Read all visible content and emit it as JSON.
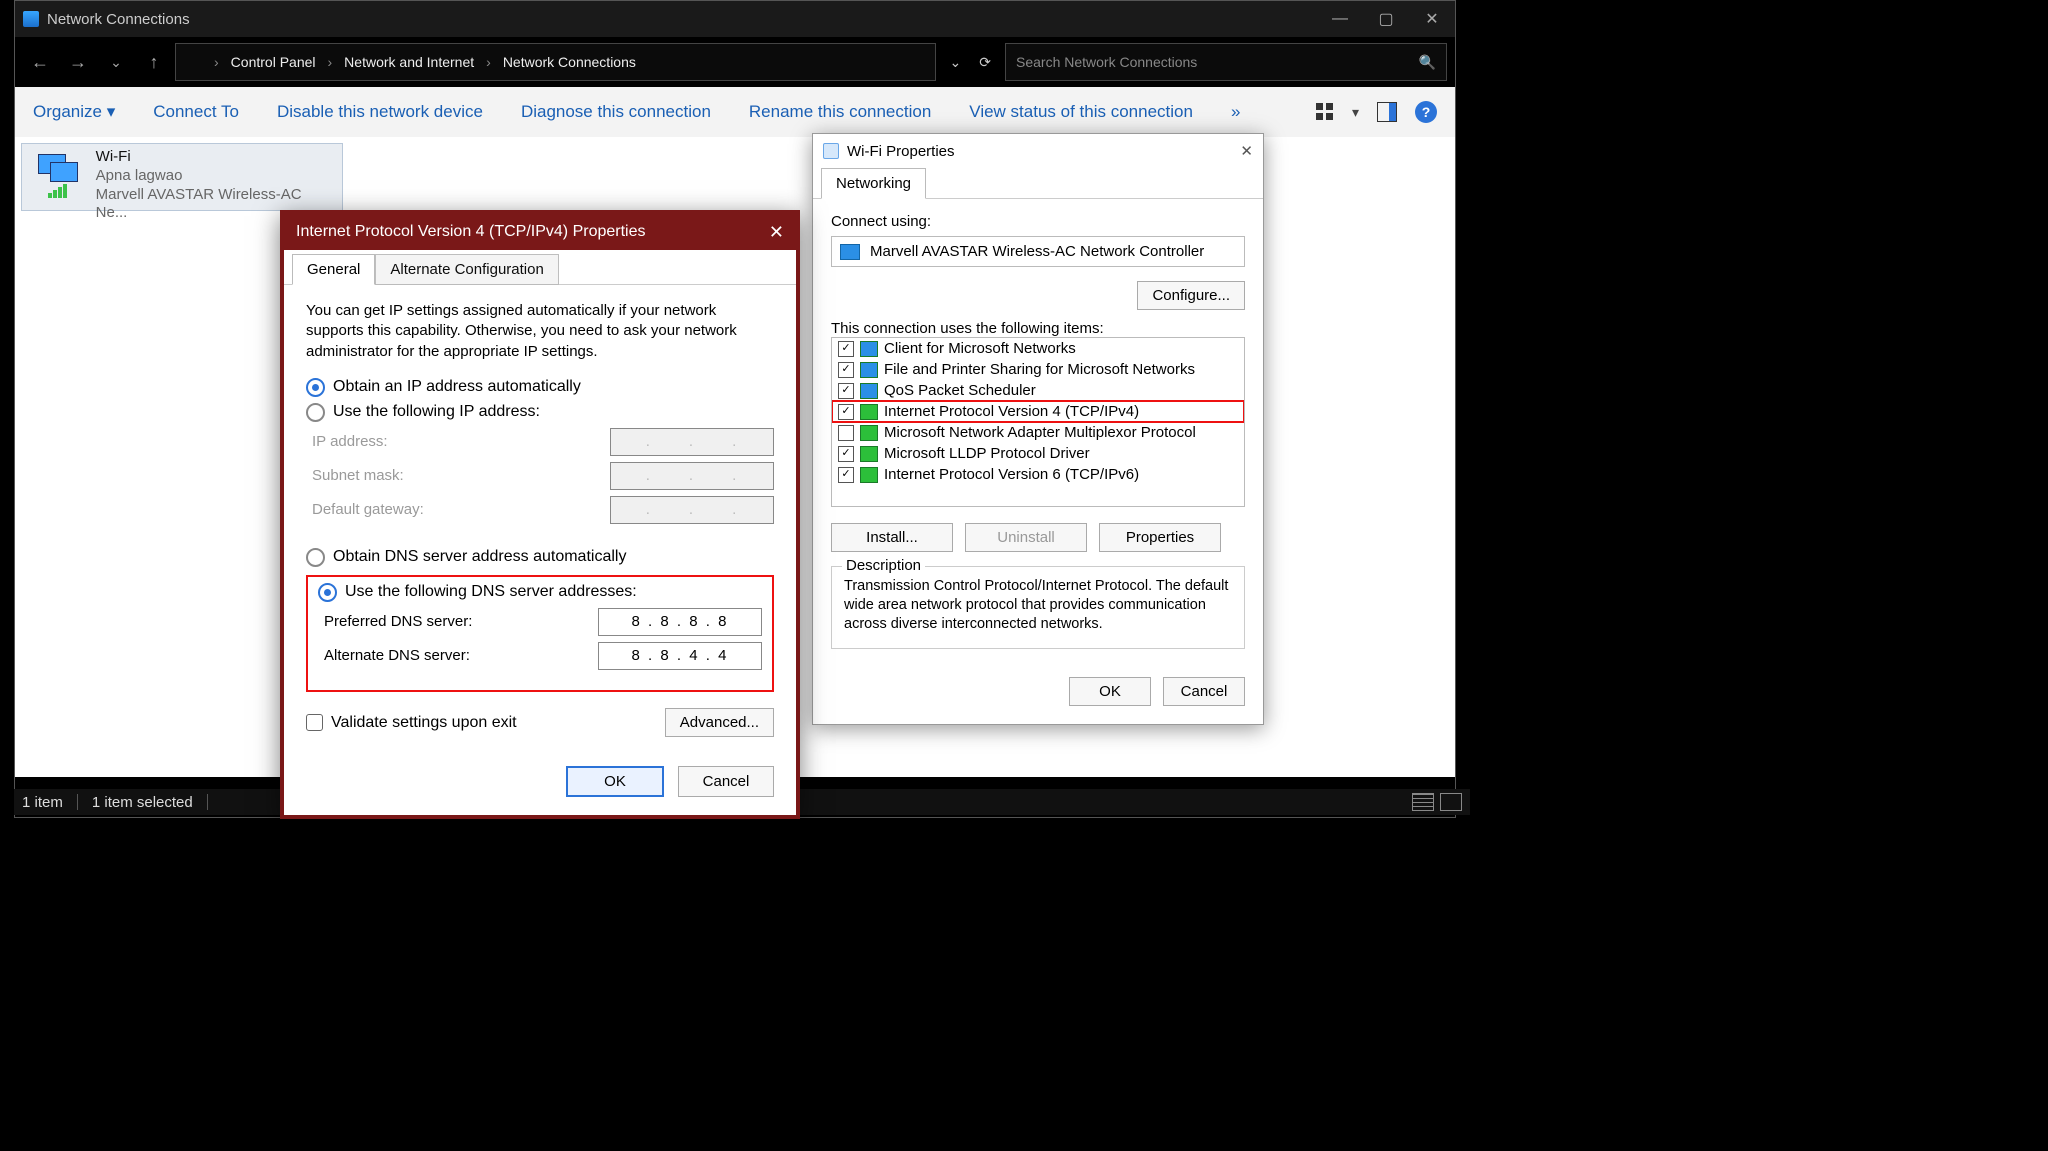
{
  "explorer": {
    "title": "Network Connections",
    "breadcrumb": [
      "Control Panel",
      "Network and Internet",
      "Network Connections"
    ],
    "search_placeholder": "Search Network Connections",
    "commands": {
      "organize": "Organize ▾",
      "connect": "Connect To",
      "disable": "Disable this network device",
      "diagnose": "Diagnose this connection",
      "rename": "Rename this connection",
      "status": "View status of this connection",
      "more": "»"
    },
    "tile": {
      "name": "Wi-Fi",
      "network": "Apna lagwao",
      "adapter": "Marvell AVASTAR Wireless-AC Ne..."
    },
    "status": {
      "count": "1 item",
      "selected": "1 item selected"
    }
  },
  "wifiProps": {
    "title": "Wi-Fi Properties",
    "tab": "Networking",
    "connect_label": "Connect using:",
    "adapter": "Marvell AVASTAR Wireless-AC Network Controller",
    "configure": "Configure...",
    "items_label": "This connection uses the following items:",
    "items": [
      {
        "checked": true,
        "label": "Client for Microsoft Networks",
        "hl": false
      },
      {
        "checked": true,
        "label": "File and Printer Sharing for Microsoft Networks",
        "hl": false
      },
      {
        "checked": true,
        "label": "QoS Packet Scheduler",
        "hl": false
      },
      {
        "checked": true,
        "label": "Internet Protocol Version 4 (TCP/IPv4)",
        "hl": true
      },
      {
        "checked": false,
        "label": "Microsoft Network Adapter Multiplexor Protocol",
        "hl": false
      },
      {
        "checked": true,
        "label": "Microsoft LLDP Protocol Driver",
        "hl": false
      },
      {
        "checked": true,
        "label": "Internet Protocol Version 6 (TCP/IPv6)",
        "hl": false
      }
    ],
    "install": "Install...",
    "uninstall": "Uninstall",
    "properties": "Properties",
    "desc_label": "Description",
    "desc": "Transmission Control Protocol/Internet Protocol. The default wide area network protocol that provides communication across diverse interconnected networks.",
    "ok": "OK",
    "cancel": "Cancel"
  },
  "ipv4": {
    "title": "Internet Protocol Version 4 (TCP/IPv4) Properties",
    "tab_general": "General",
    "tab_alt": "Alternate Configuration",
    "intro": "You can get IP settings assigned automatically if your network supports this capability. Otherwise, you need to ask your network administrator for the appropriate IP settings.",
    "obtain_ip": "Obtain an IP address automatically",
    "use_ip": "Use the following IP address:",
    "ip_label": "IP address:",
    "subnet_label": "Subnet mask:",
    "gateway_label": "Default gateway:",
    "obtain_dns": "Obtain DNS server address automatically",
    "use_dns": "Use the following DNS server addresses:",
    "pref_dns_label": "Preferred DNS server:",
    "alt_dns_label": "Alternate DNS server:",
    "pref_dns": "8  .  8  .  8  .  8",
    "alt_dns": "8  .  8  .  4  .  4",
    "validate": "Validate settings upon exit",
    "advanced": "Advanced...",
    "ok": "OK",
    "cancel": "Cancel"
  }
}
